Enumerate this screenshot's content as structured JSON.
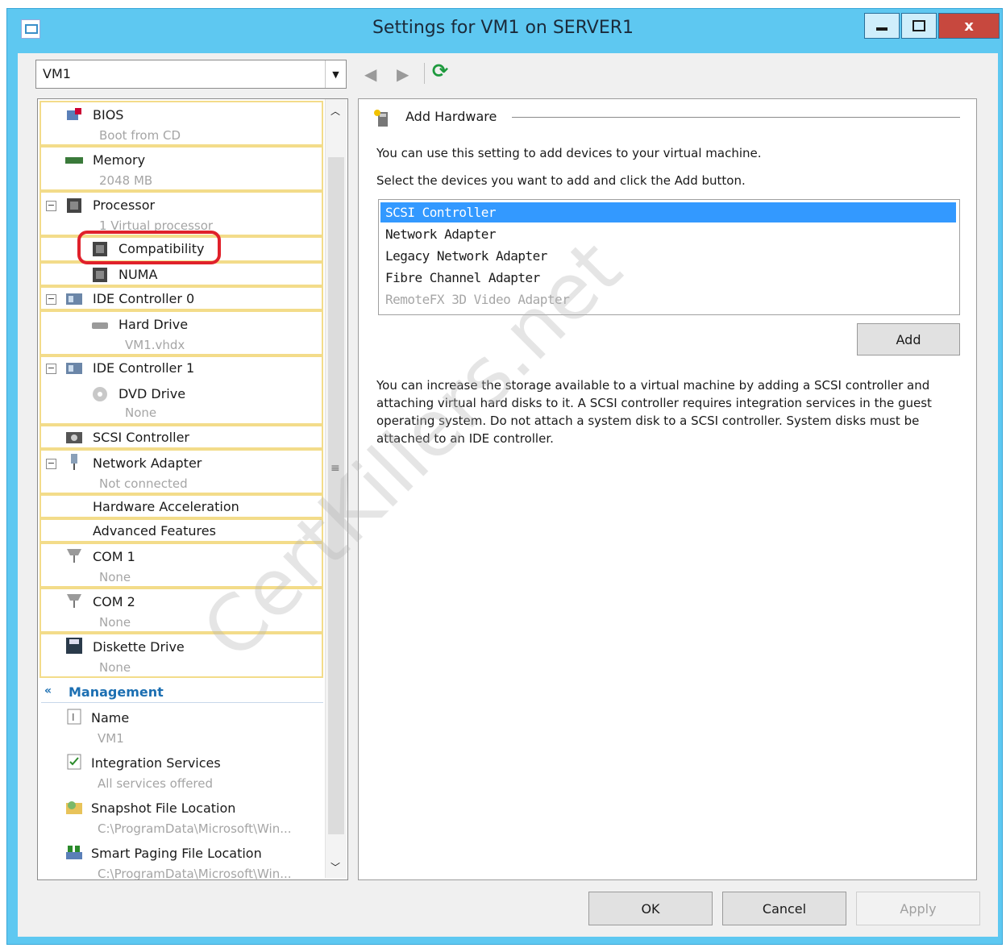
{
  "window": {
    "title": "Settings for VM1 on SERVER1",
    "close_label": "x"
  },
  "vm_selector": {
    "value": "VM1"
  },
  "tree": {
    "items": [
      {
        "label": "BIOS",
        "sub": "Boot from CD",
        "icon": "bios-icon"
      },
      {
        "label": "Memory",
        "sub": "2048 MB",
        "icon": "memory-icon"
      },
      {
        "label": "Processor",
        "sub": "1 Virtual processor",
        "icon": "processor-icon"
      },
      {
        "label": "Compatibility",
        "icon": "chip-icon"
      },
      {
        "label": "NUMA",
        "icon": "chip-icon"
      },
      {
        "label": "IDE Controller 0",
        "icon": "ide-controller-icon"
      },
      {
        "label": "Hard Drive",
        "sub": "VM1.vhdx",
        "icon": "hard-drive-icon"
      },
      {
        "label": "IDE Controller 1",
        "icon": "ide-controller-icon"
      },
      {
        "label": "DVD Drive",
        "sub": "None",
        "icon": "dvd-drive-icon"
      },
      {
        "label": "SCSI Controller",
        "icon": "scsi-controller-icon"
      },
      {
        "label": "Network Adapter",
        "sub": "Not connected",
        "icon": "network-adapter-icon"
      },
      {
        "label": "Hardware Acceleration"
      },
      {
        "label": "Advanced Features"
      },
      {
        "label": "COM 1",
        "sub": "None",
        "icon": "com-port-icon"
      },
      {
        "label": "COM 2",
        "sub": "None",
        "icon": "com-port-icon"
      },
      {
        "label": "Diskette Drive",
        "sub": "None",
        "icon": "diskette-icon"
      }
    ],
    "management_header": "Management",
    "management": [
      {
        "label": "Name",
        "sub": "VM1",
        "icon": "name-icon"
      },
      {
        "label": "Integration Services",
        "sub": "All services offered",
        "icon": "integration-services-icon"
      },
      {
        "label": "Snapshot File Location",
        "sub": "C:\\ProgramData\\Microsoft\\Win...",
        "icon": "snapshot-folder-icon"
      },
      {
        "label": "Smart Paging File Location",
        "sub": "C:\\ProgramData\\Microsoft\\Win...",
        "icon": "smart-paging-icon"
      }
    ]
  },
  "add_hardware": {
    "title": "Add Hardware",
    "desc1": "You can use this setting to add devices to your virtual machine.",
    "desc2": "Select the devices you want to add and click the Add button.",
    "devices": [
      "SCSI Controller",
      "Network Adapter",
      "Legacy Network Adapter",
      "Fibre Channel Adapter",
      "RemoteFX 3D Video Adapter"
    ],
    "selected_device": "SCSI Controller",
    "disabled_device": "RemoteFX 3D Video Adapter",
    "add_label": "Add",
    "info": "You can increase the storage available to a virtual machine by adding a SCSI controller and attaching virtual hard disks to it. A SCSI controller requires integration services in the guest operating system. Do not attach a system disk to a SCSI controller. System disks must be attached to an IDE controller."
  },
  "buttons": {
    "ok": "OK",
    "cancel": "Cancel",
    "apply": "Apply"
  },
  "watermark": "CertKillers.net",
  "colors": {
    "titlebar": "#5ec8f1",
    "selection": "#3399ff",
    "highlight": "#e0212b",
    "group_border": "#f3dc8a"
  }
}
